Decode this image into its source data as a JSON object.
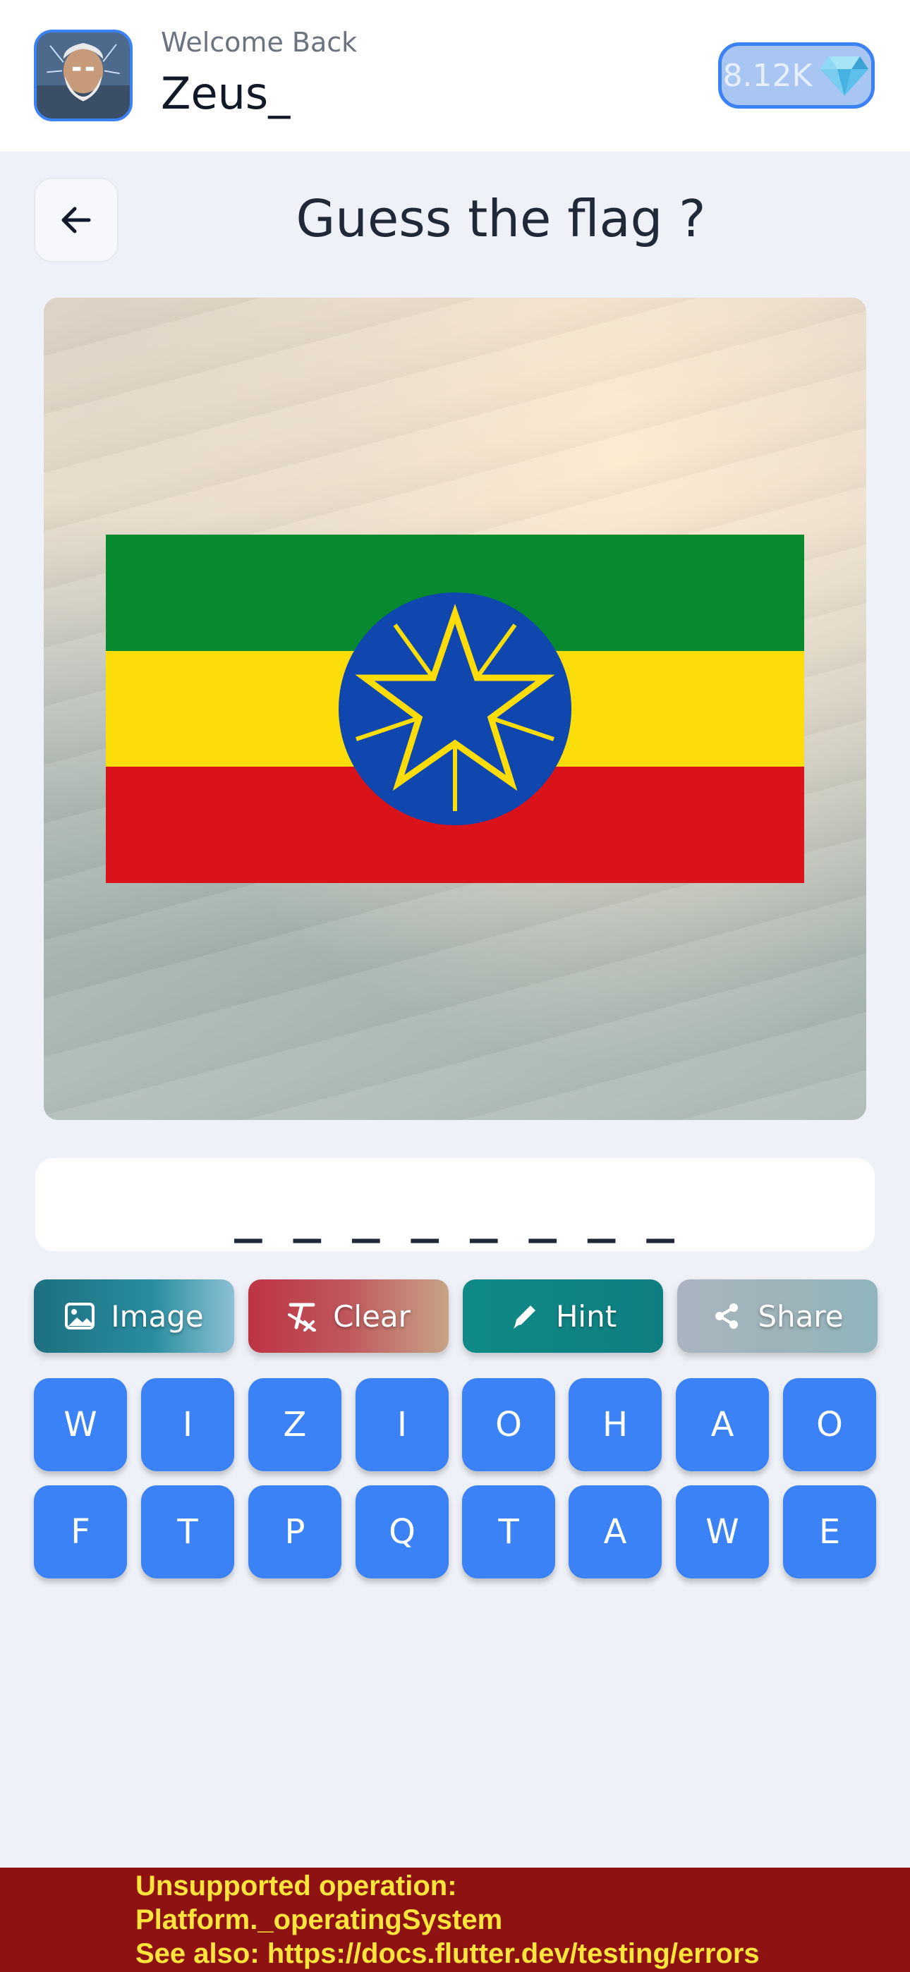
{
  "header": {
    "welcome": "Welcome Back",
    "username": "Zeus_",
    "gems": "8.12K"
  },
  "page": {
    "title": "Guess the flag ?"
  },
  "answer": {
    "text": "_ _ _ _ _ _ _ _"
  },
  "actions": [
    {
      "label": "Image",
      "icon": "image-icon"
    },
    {
      "label": "Clear",
      "icon": "clear-format-icon"
    },
    {
      "label": "Hint",
      "icon": "pencil-icon"
    },
    {
      "label": "Share",
      "icon": "share-icon"
    }
  ],
  "keyboard": {
    "row1": [
      "W",
      "I",
      "Z",
      "I",
      "O",
      "H",
      "A",
      "O"
    ],
    "row2": [
      "F",
      "T",
      "P",
      "Q",
      "T",
      "A",
      "W",
      "E"
    ]
  },
  "error": {
    "line1": "Unsupported operation:",
    "line2": "Platform._operatingSystem",
    "line3": "See also: https://docs.flutter.dev/testing/errors"
  },
  "colors": {
    "accent": "#3b82f6",
    "error_bg": "#8f1212",
    "error_text": "#ffe43b",
    "flag_green": "#078930",
    "flag_yellow": "#fcdd09",
    "flag_red": "#da121a",
    "flag_blue": "#0f47af"
  }
}
